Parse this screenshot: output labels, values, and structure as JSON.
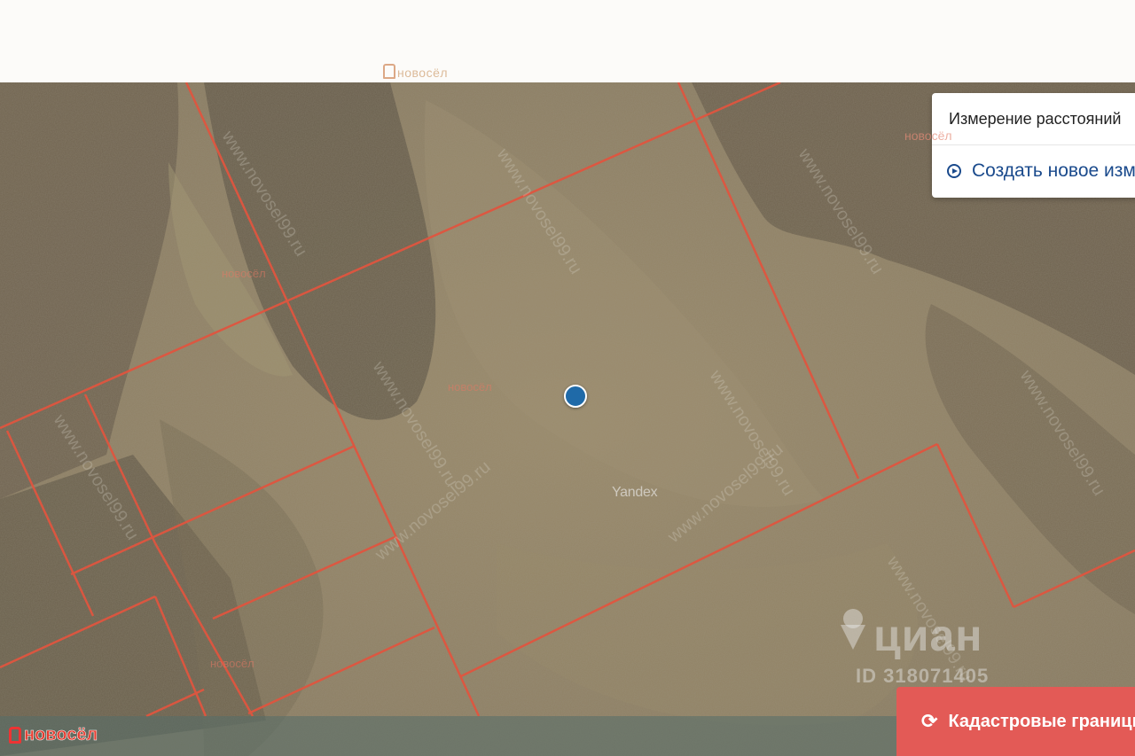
{
  "watermarks": {
    "top_logo_text": "новосёл",
    "panel_logo_text": "новосёл",
    "site_text": "www.novosel99.ru",
    "yandex": "Yandex",
    "cian_brand": "циан",
    "cian_id": "ID 318071405"
  },
  "measure_panel": {
    "title": "Измерение расстояний",
    "create_label": "Создать новое измерение",
    "icon": "play-circle-icon"
  },
  "brand": {
    "label": "новосёл",
    "color": "#e63a2e"
  },
  "cadastral_button": {
    "label": "Кадастровые границы",
    "icon": "refresh-icon",
    "color": "#e35a56"
  },
  "map": {
    "boundary_color": "#e0553f",
    "location_marker_color": "#1f6aa8"
  }
}
